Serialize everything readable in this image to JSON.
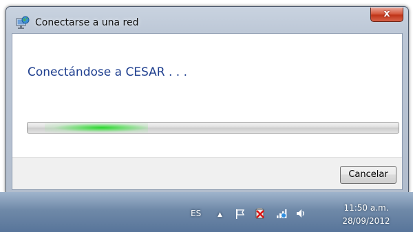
{
  "window": {
    "title": "Conectarse a una red",
    "close_label": "x",
    "heading": "Conectándose a CESAR . . .",
    "cancel_label": "Cancelar"
  },
  "taskbar": {
    "language": "ES",
    "time": "11:50 a.m.",
    "date": "28/09/2012",
    "icons": [
      "show-hidden-icons-icon",
      "action-center-flag-icon",
      "power-icon",
      "network-icon",
      "volume-icon"
    ]
  },
  "colors": {
    "heading_text": "#1f3f8f",
    "progress_glow": "#29d62d",
    "taskbar": "#6f89a8"
  }
}
